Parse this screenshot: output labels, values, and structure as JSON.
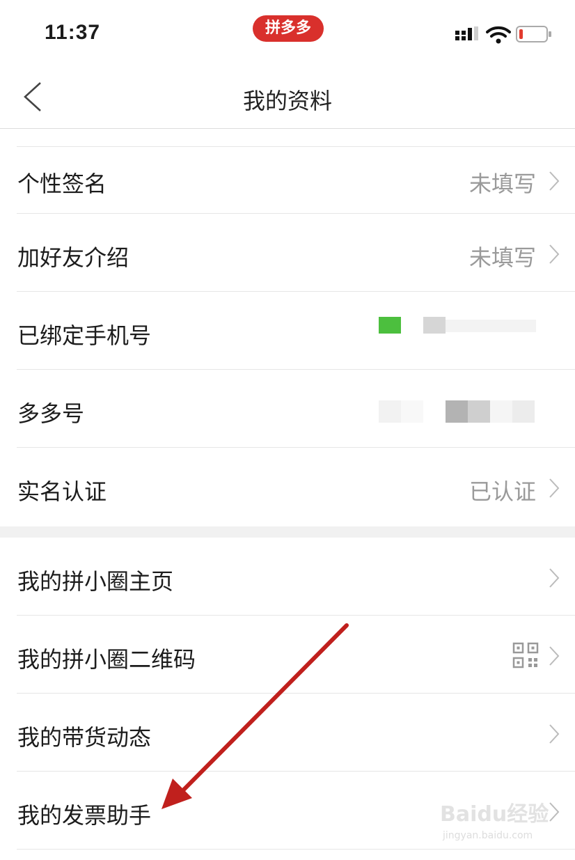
{
  "status_bar": {
    "time": "11:37",
    "app_badge": "拼多多",
    "battery_color": "#e23b2e"
  },
  "nav": {
    "title": "我的资料",
    "back_icon": "chevron-left-icon"
  },
  "section1": [
    {
      "label": "个性签名",
      "value": "未填写"
    },
    {
      "label": "加好友介绍",
      "value": "未填写"
    },
    {
      "label": "已绑定手机号",
      "value": ""
    },
    {
      "label": "多多号",
      "value": ""
    },
    {
      "label": "实名认证",
      "value": "已认证"
    }
  ],
  "section2": [
    {
      "label": "我的拼小圈主页"
    },
    {
      "label": "我的拼小圈二维码",
      "icon": "qr-code-icon"
    },
    {
      "label": "我的带货动态"
    },
    {
      "label": "我的发票助手"
    }
  ],
  "annotation": {
    "arrow_color": "#c0201d"
  },
  "watermark": {
    "line1": "Baidu经验",
    "line2": "jingyan.baidu.com"
  }
}
